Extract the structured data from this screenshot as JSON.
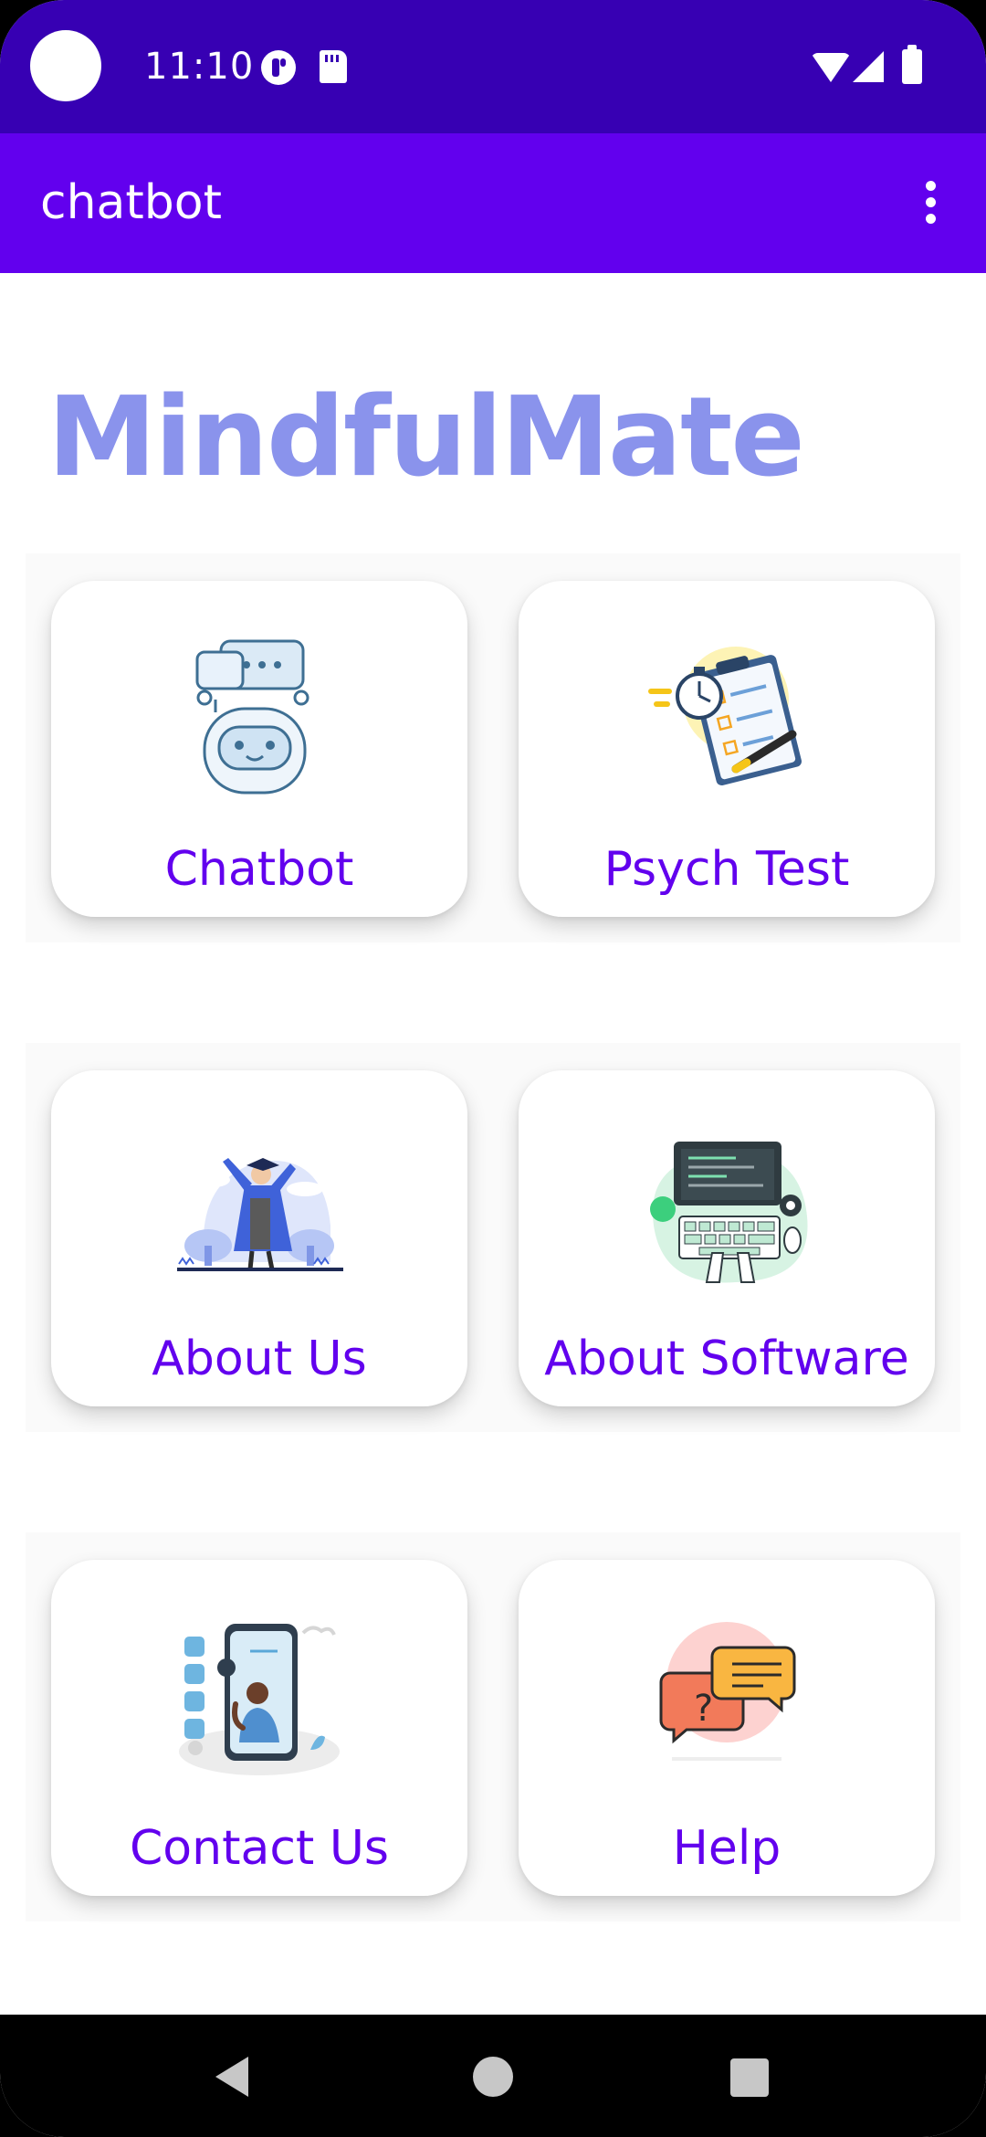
{
  "status_bar": {
    "time": "11:10",
    "icons": [
      "camera-cutout",
      "t-app-icon",
      "sd-card-icon",
      "wifi-icon",
      "signal-icon",
      "battery-icon"
    ]
  },
  "app_bar": {
    "title": "chatbot",
    "menu_icon": "more-vert-icon"
  },
  "brand": {
    "name": "MindfulMate",
    "color": "#8a93ec"
  },
  "menu": {
    "items": [
      {
        "label": "Chatbot",
        "icon": "robot-chat-illustration"
      },
      {
        "label": "Psych Test",
        "icon": "clipboard-stopwatch-illustration"
      },
      {
        "label": "About Us",
        "icon": "graduate-illustration"
      },
      {
        "label": "About Software",
        "icon": "laptop-keyboard-illustration"
      },
      {
        "label": "Contact Us",
        "icon": "phone-support-illustration"
      },
      {
        "label": "Help",
        "icon": "help-chat-bubbles-illustration"
      }
    ]
  },
  "theme": {
    "primary": "#6200ee",
    "primary_dark": "#3700b3",
    "label_color": "#6200ee"
  },
  "nav_bar": {
    "icons": [
      "back-icon",
      "home-icon",
      "recents-icon"
    ]
  }
}
